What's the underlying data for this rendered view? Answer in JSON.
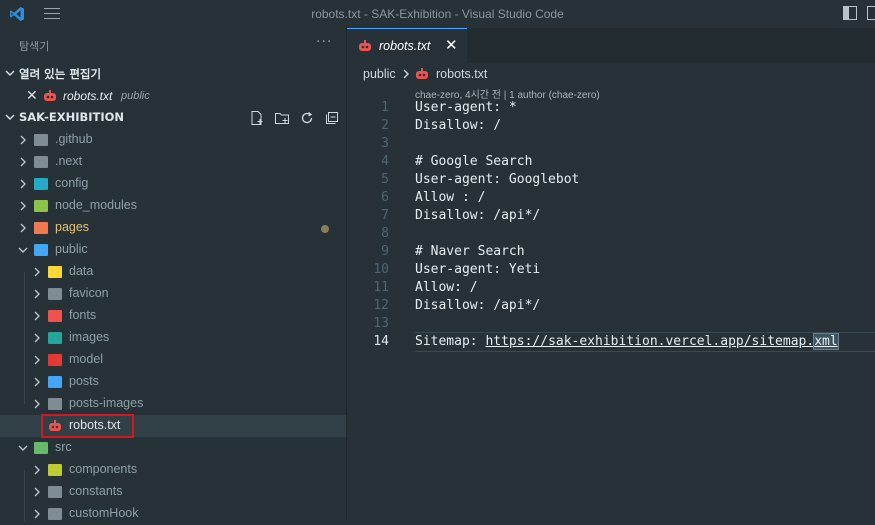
{
  "window": {
    "title": "robots.txt - SAK-Exhibition - Visual Studio Code"
  },
  "sidebar": {
    "header_label": "탐색기",
    "more_label": "···",
    "open_editors": {
      "title": "열려 있는 편집기",
      "items": [
        {
          "name": "robots.txt",
          "path": "public"
        }
      ]
    },
    "project": {
      "title": "SAK-EXHIBITION",
      "tree": [
        {
          "label": ".github",
          "depth": 0,
          "icon_color": "#7f8c93"
        },
        {
          "label": ".next",
          "depth": 0,
          "icon_color": "#7f8c93"
        },
        {
          "label": "config",
          "depth": 0,
          "icon_color": "#26a9c7"
        },
        {
          "label": "node_modules",
          "depth": 0,
          "icon_color": "#8bc34a"
        },
        {
          "label": "pages",
          "depth": 0,
          "icon_color": "#ef7a52"
        },
        {
          "label": "public",
          "depth": 0,
          "icon_color": "#42a5f5"
        },
        {
          "label": "data",
          "depth": 1,
          "icon_color": "#fdd835"
        },
        {
          "label": "favicon",
          "depth": 1,
          "icon_color": "#7f8c93"
        },
        {
          "label": "fonts",
          "depth": 1,
          "icon_color": "#ef5350"
        },
        {
          "label": "images",
          "depth": 1,
          "icon_color": "#26a69a"
        },
        {
          "label": "model",
          "depth": 1,
          "icon_color": "#e53935"
        },
        {
          "label": "posts",
          "depth": 1,
          "icon_color": "#42a5f5"
        },
        {
          "label": "posts-images",
          "depth": 1,
          "icon_color": "#7f8c93"
        },
        {
          "label": "robots.txt",
          "depth": 1,
          "icon_color": "#ef5350"
        },
        {
          "label": "src",
          "depth": 0,
          "icon_color": "#66bb6a"
        },
        {
          "label": "components",
          "depth": 1,
          "icon_color": "#c0ca33"
        },
        {
          "label": "constants",
          "depth": 1,
          "icon_color": "#7f8c93"
        },
        {
          "label": "customHook",
          "depth": 1,
          "icon_color": "#7f8c93"
        }
      ]
    }
  },
  "editor": {
    "tab": {
      "name": "robots.txt",
      "close": "✕"
    },
    "breadcrumb": {
      "folder": "public",
      "file": "robots.txt"
    },
    "codelens": "chae-zero, 4시간 전 | 1 author (chae-zero)",
    "lines": [
      {
        "n": "1",
        "text": "User-agent: *"
      },
      {
        "n": "2",
        "text": "Disallow: /"
      },
      {
        "n": "3",
        "text": ""
      },
      {
        "n": "4",
        "text": "# Google Search"
      },
      {
        "n": "5",
        "text": "User-agent: Googlebot"
      },
      {
        "n": "6",
        "text": "Allow : /"
      },
      {
        "n": "7",
        "text": "Disallow: /api*/"
      },
      {
        "n": "8",
        "text": ""
      },
      {
        "n": "9",
        "text": "# Naver Search"
      },
      {
        "n": "10",
        "text": "User-agent: Yeti"
      },
      {
        "n": "11",
        "text": "Allow: /"
      },
      {
        "n": "12",
        "text": "Disallow: /api*/"
      },
      {
        "n": "13",
        "text": ""
      },
      {
        "n": "14",
        "text_prefix": "Sitemap: ",
        "url_main": "https://sak-exhibition.vercel.app/sitemap.",
        "url_sel": "xml"
      }
    ]
  }
}
